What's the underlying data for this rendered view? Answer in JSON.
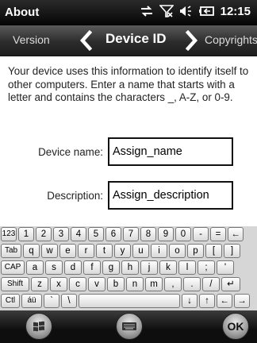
{
  "status_bar": {
    "title": "About",
    "time": "12:15"
  },
  "tabs": {
    "prev": "Version",
    "current": "Device ID",
    "next": "Copyrights"
  },
  "description": "Your device uses this information to identify itself to other computers. Enter a name that starts with a letter and contains the characters _, A-Z, or 0-9.",
  "form": {
    "device_name_label": "Device name:",
    "device_name_value": "Assign_name",
    "description_label": "Description:",
    "description_value": "Assign_description"
  },
  "keyboard": {
    "rows": [
      [
        "123",
        "1",
        "2",
        "3",
        "4",
        "5",
        "6",
        "7",
        "8",
        "9",
        "0",
        "-",
        "=",
        "←"
      ],
      [
        "Tab",
        "q",
        "w",
        "e",
        "r",
        "t",
        "y",
        "u",
        "i",
        "o",
        "p",
        "[",
        "]"
      ],
      [
        "CAP",
        "a",
        "s",
        "d",
        "f",
        "g",
        "h",
        "j",
        "k",
        "l",
        ";",
        "'"
      ],
      [
        "Shift",
        "z",
        "x",
        "c",
        "v",
        "b",
        "n",
        "m",
        ",",
        ".",
        "/",
        "↵"
      ],
      [
        "Ctl",
        "áü",
        "`",
        "\\",
        " ",
        "↓",
        "↑",
        "←",
        "→"
      ]
    ]
  },
  "softkeys": {
    "ok_label": "OK"
  },
  "colors": {
    "header_bg": "#2c2c2c",
    "keyboard_bg": "#d6d6d6"
  }
}
